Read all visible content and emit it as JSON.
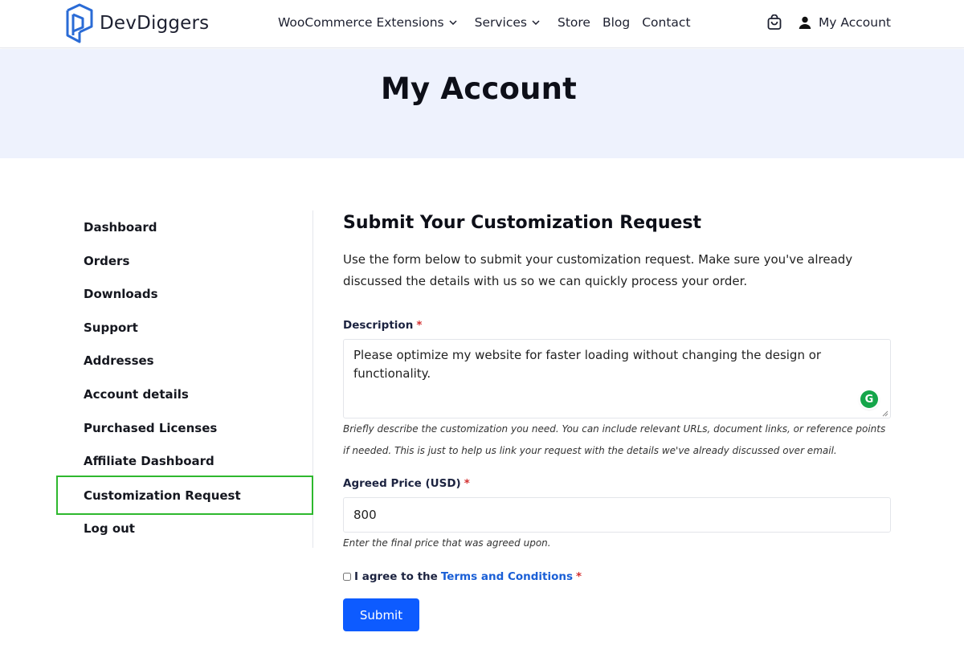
{
  "header": {
    "brand": "DevDiggers",
    "nav": [
      {
        "label": "WooCommerce Extensions",
        "has_dropdown": true
      },
      {
        "label": "Services",
        "has_dropdown": true
      },
      {
        "label": "Store",
        "has_dropdown": false
      },
      {
        "label": "Blog",
        "has_dropdown": false
      },
      {
        "label": "Contact",
        "has_dropdown": false
      }
    ],
    "cart_icon": "shopping-bag-icon",
    "account_icon": "user-icon",
    "account_label": "My Account"
  },
  "hero": {
    "title": "My Account"
  },
  "sidebar": {
    "items": [
      {
        "label": "Dashboard"
      },
      {
        "label": "Orders"
      },
      {
        "label": "Downloads"
      },
      {
        "label": "Support"
      },
      {
        "label": "Addresses"
      },
      {
        "label": "Account details"
      },
      {
        "label": "Purchased Licenses"
      },
      {
        "label": "Affiliate Dashboard"
      },
      {
        "label": "Customization Request"
      },
      {
        "label": "Log out"
      }
    ],
    "active_item": "Customization Request",
    "highlight_color": "#2eb82e"
  },
  "form": {
    "title": "Submit Your Customization Request",
    "intro": "Use the form below to submit your customization request. Make sure you've already discussed the details with us so we can quickly process your order.",
    "description_label": "Description",
    "required_mark": "*",
    "description_value": "Please optimize my website for faster loading without changing the design or functionality.",
    "description_help": "Briefly describe the customization you need. You can include relevant URLs, document links, or reference points if needed. This is just to help us link your request with the details we've already discussed over email.",
    "price_label": "Agreed Price (USD)",
    "price_value": "800",
    "price_help": "Enter the final price that was agreed upon.",
    "agree_text": "I agree to the",
    "terms_link": "Terms and Conditions",
    "submit_label": "Submit",
    "grammarly_glyph": "G"
  },
  "colors": {
    "accent": "#0d5bff",
    "link": "#1a5fd6",
    "hero_bg": "#eef2fd",
    "required": "#d32f2f"
  }
}
